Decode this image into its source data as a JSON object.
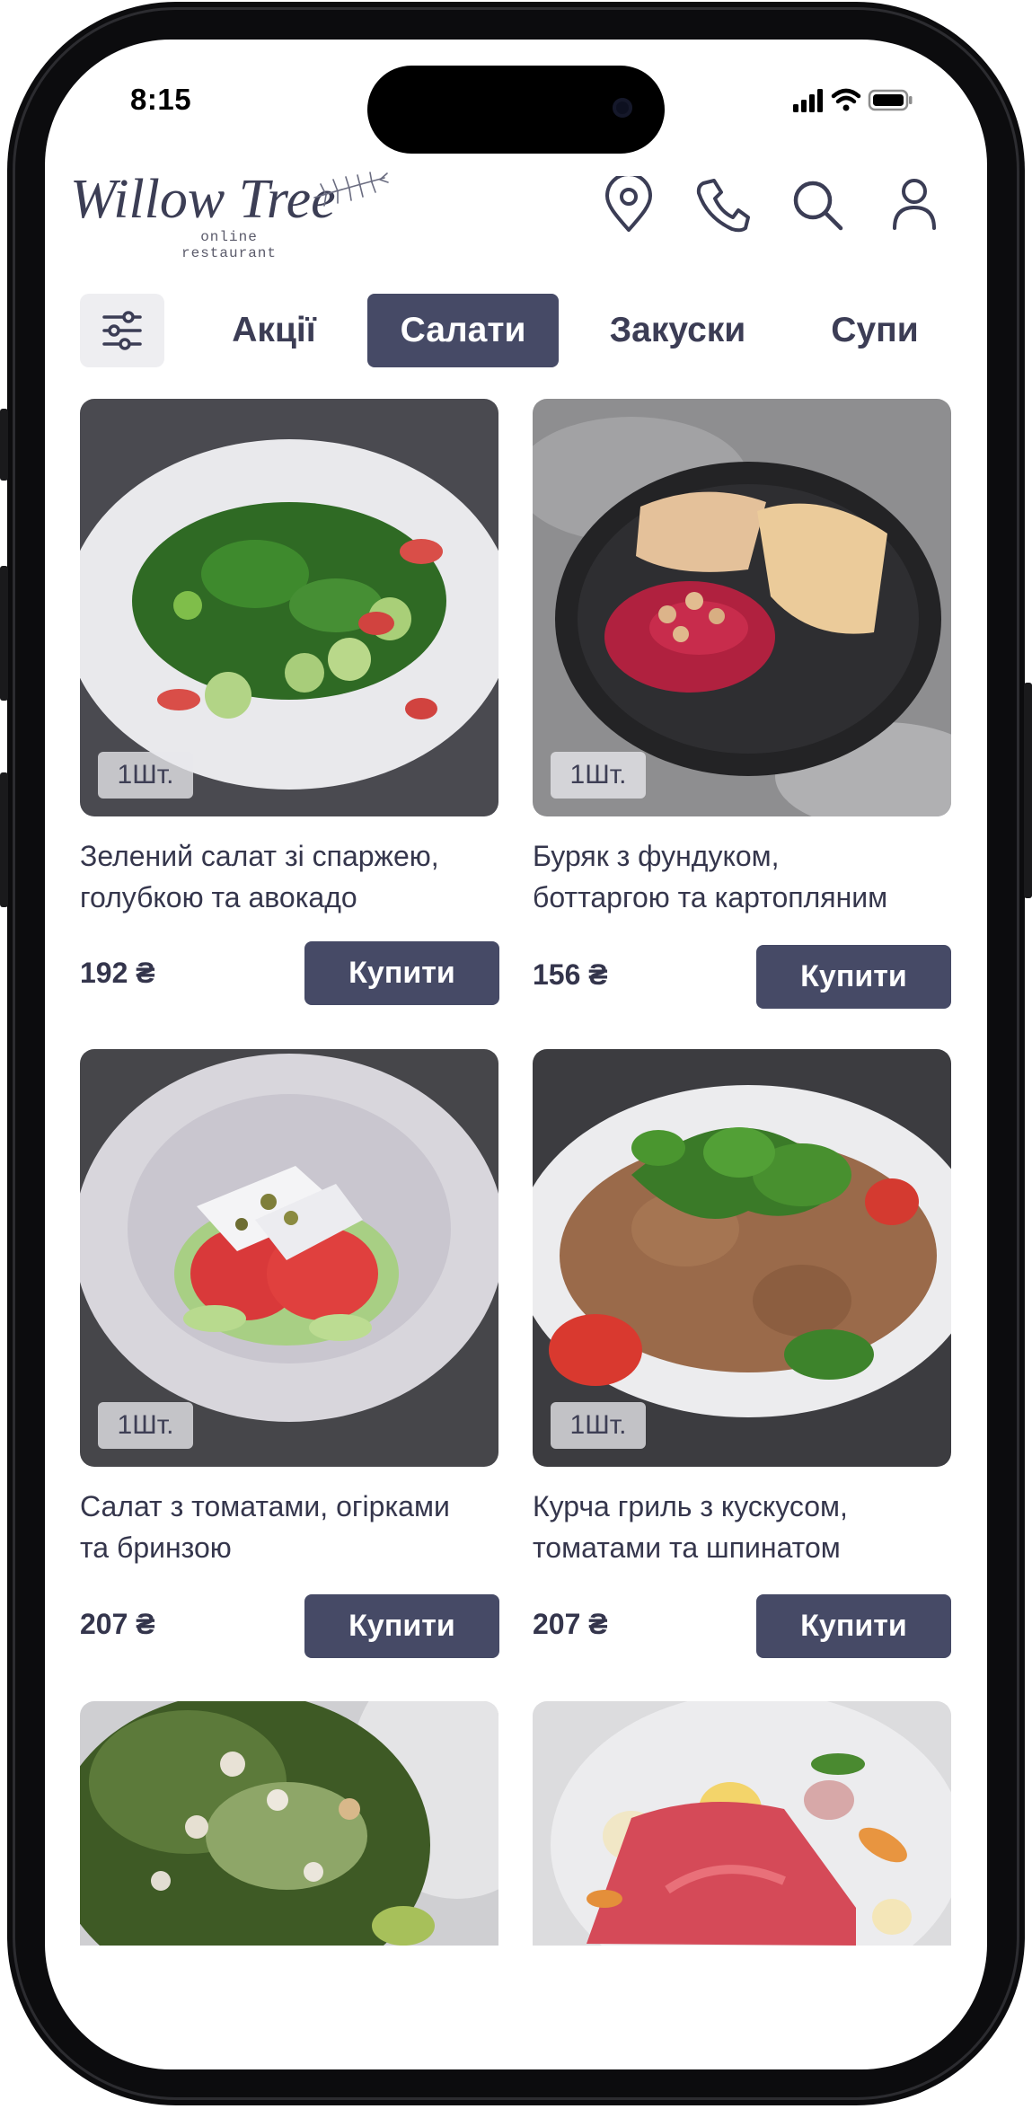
{
  "status_bar": {
    "time": "8:15"
  },
  "brand": {
    "name": "Willow Tree",
    "tagline": "online restaurant"
  },
  "header_icons": [
    "location-pin-icon",
    "phone-icon",
    "search-icon",
    "user-icon"
  ],
  "filter": {
    "icon": "filter-sliders-icon"
  },
  "categories": [
    {
      "label": "Акції",
      "active": false
    },
    {
      "label": "Салати",
      "active": true
    },
    {
      "label": "Закуски",
      "active": false
    },
    {
      "label": "Супи",
      "active": false
    }
  ],
  "products": [
    {
      "qty": "1Шт.",
      "title_line1": "Зелений салат зі спаржею,",
      "title_line2": "голубкою та авокадо",
      "price": "192 ₴",
      "buy_label": "Купити"
    },
    {
      "qty": "1Шт.",
      "title_line1": "Буряк з фундуком,",
      "title_line2": "боттаргою та картопляним",
      "price": "156 ₴",
      "buy_label": "Купити"
    },
    {
      "qty": "1Шт.",
      "title_line1": "Салат з томатами, огірками",
      "title_line2": "та бринзою",
      "price": "207 ₴",
      "buy_label": "Купити"
    },
    {
      "qty": "1Шт.",
      "title_line1": "Курча гриль з кускусом,",
      "title_line2": "томатами та шпинатом",
      "price": "207 ₴",
      "buy_label": "Купити"
    }
  ],
  "colors": {
    "accent": "#464a66",
    "text": "#35364c",
    "badge_bg": "#e8e8ec"
  }
}
